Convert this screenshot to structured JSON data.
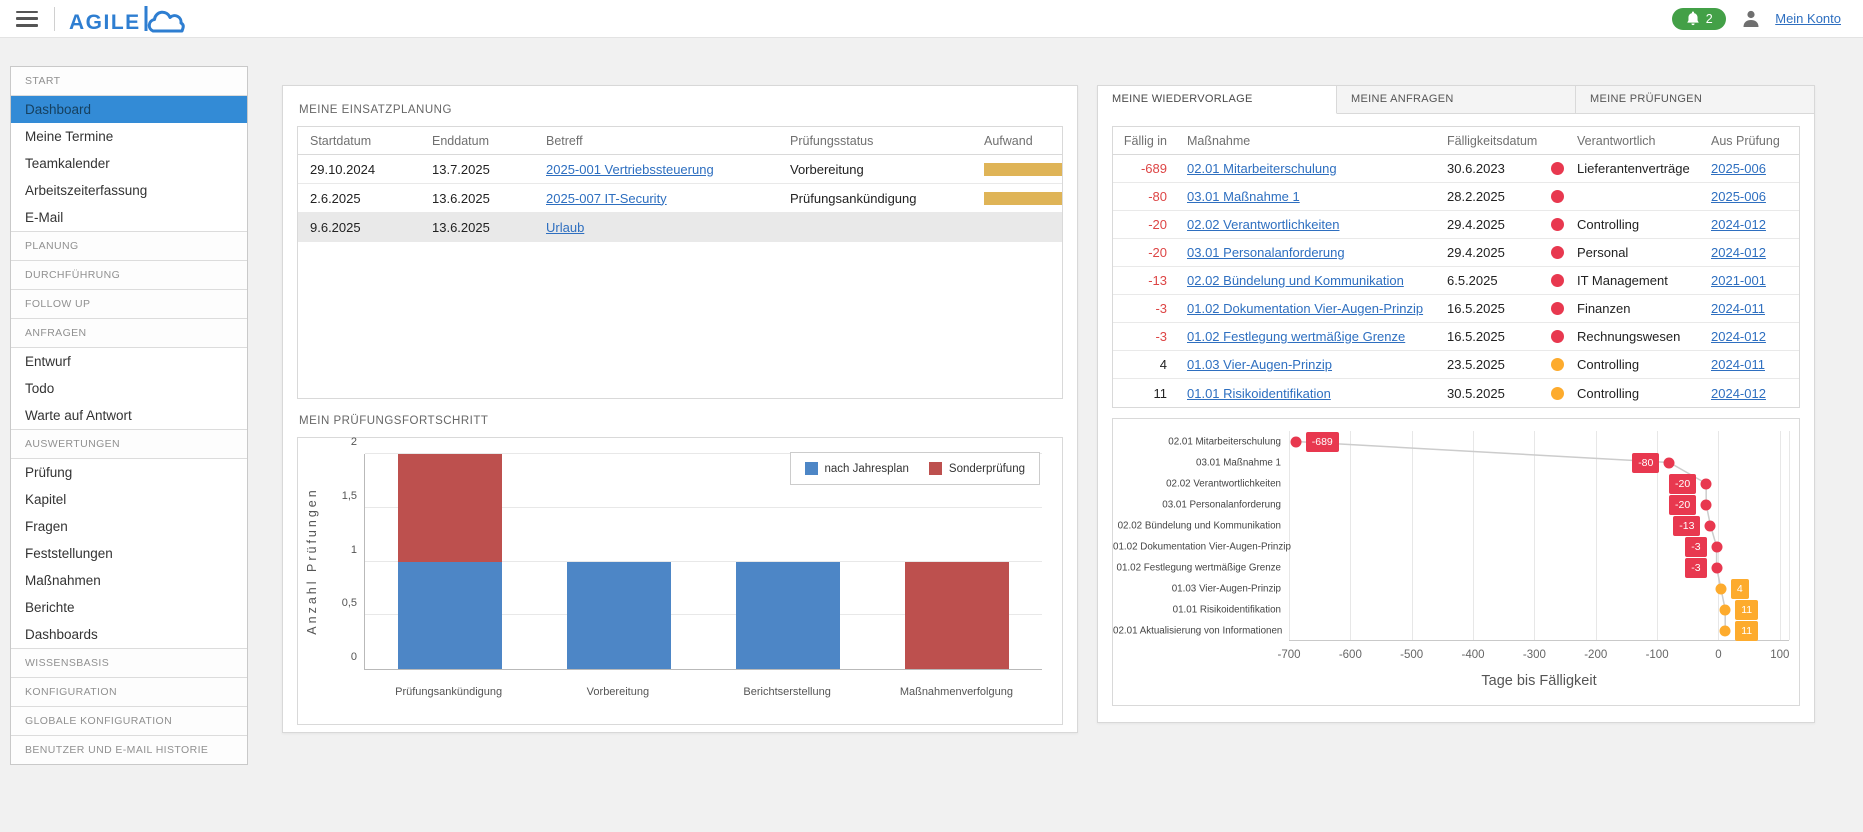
{
  "header": {
    "brand": "AGILE",
    "notification_count": "2",
    "account_link": "Mein Konto"
  },
  "sidebar": {
    "items": [
      {
        "type": "header",
        "label": "START"
      },
      {
        "type": "item",
        "label": "Dashboard",
        "active": true
      },
      {
        "type": "item",
        "label": "Meine Termine"
      },
      {
        "type": "item",
        "label": "Teamkalender"
      },
      {
        "type": "item",
        "label": "Arbeitszeiterfassung"
      },
      {
        "type": "item",
        "label": "E-Mail"
      },
      {
        "type": "header",
        "label": "PLANUNG"
      },
      {
        "type": "header",
        "label": "DURCHFÜHRUNG"
      },
      {
        "type": "header",
        "label": "FOLLOW UP"
      },
      {
        "type": "header",
        "label": "ANFRAGEN"
      },
      {
        "type": "item",
        "label": "Entwurf"
      },
      {
        "type": "item",
        "label": "Todo"
      },
      {
        "type": "item",
        "label": "Warte auf Antwort"
      },
      {
        "type": "header",
        "label": "AUSWERTUNGEN"
      },
      {
        "type": "item",
        "label": "Prüfung"
      },
      {
        "type": "item",
        "label": "Kapitel"
      },
      {
        "type": "item",
        "label": "Fragen"
      },
      {
        "type": "item",
        "label": "Feststellungen"
      },
      {
        "type": "item",
        "label": "Maßnahmen"
      },
      {
        "type": "item",
        "label": "Berichte"
      },
      {
        "type": "item",
        "label": "Dashboards"
      },
      {
        "type": "header",
        "label": "WISSENSBASIS"
      },
      {
        "type": "header",
        "label": "KONFIGURATION"
      },
      {
        "type": "header",
        "label": "GLOBALE KONFIGURATION"
      },
      {
        "type": "header",
        "label": "BENUTZER UND E-MAIL HISTORIE"
      }
    ]
  },
  "einsatzplanung": {
    "title": "MEINE EINSATZPLANUNG",
    "columns": [
      "Startdatum",
      "Enddatum",
      "Betreff",
      "Prüfungsstatus",
      "Aufwand"
    ],
    "rows": [
      {
        "start": "29.10.2024",
        "end": "13.7.2025",
        "betreff": "2025-001 Vertriebssteuerung",
        "status": "Vorbereitung",
        "aufwand": true,
        "selected": false
      },
      {
        "start": "2.6.2025",
        "end": "13.6.2025",
        "betreff": "2025-007 IT-Security",
        "status": "Prüfungsankündigung",
        "aufwand": true,
        "selected": false
      },
      {
        "start": "9.6.2025",
        "end": "13.6.2025",
        "betreff": "Urlaub",
        "status": "",
        "aufwand": false,
        "selected": true
      }
    ]
  },
  "fortschritt": {
    "title": "MEIN PRÜFUNGSFORTSCHRITT"
  },
  "right_panel": {
    "tabs": [
      "MEINE WIEDERVORLAGE",
      "MEINE ANFRAGEN",
      "MEINE PRÜFUNGEN"
    ],
    "active_tab": 0,
    "columns": [
      "Fällig in",
      "Maßnahme",
      "Fälligkeitsdatum",
      "",
      "Verantwortlich",
      "Aus Prüfung"
    ],
    "rows": [
      {
        "faellig": "-689",
        "massnahme": "02.01 Mitarbeiterschulung",
        "datum": "30.6.2023",
        "dot": "red",
        "verantwortlich": "Lieferantenverträge",
        "pruefung": "2025-006"
      },
      {
        "faellig": "-80",
        "massnahme": "03.01 Maßnahme 1",
        "datum": "28.2.2025",
        "dot": "red",
        "verantwortlich": "",
        "pruefung": "2025-006"
      },
      {
        "faellig": "-20",
        "massnahme": "02.02 Verantwortlichkeiten",
        "datum": "29.4.2025",
        "dot": "red",
        "verantwortlich": "Controlling",
        "pruefung": "2024-012"
      },
      {
        "faellig": "-20",
        "massnahme": "03.01 Personalanforderung",
        "datum": "29.4.2025",
        "dot": "red",
        "verantwortlich": "Personal",
        "pruefung": "2024-012"
      },
      {
        "faellig": "-13",
        "massnahme": "02.02 Bündelung und Kommunikation",
        "datum": "6.5.2025",
        "dot": "red",
        "verantwortlich": "IT Management",
        "pruefung": "2021-001"
      },
      {
        "faellig": "-3",
        "massnahme": "01.02 Dokumentation Vier-Augen-Prinzip",
        "datum": "16.5.2025",
        "dot": "red",
        "verantwortlich": "Finanzen",
        "pruefung": "2024-011"
      },
      {
        "faellig": "-3",
        "massnahme": "01.02 Festlegung wertmäßige Grenze",
        "datum": "16.5.2025",
        "dot": "red",
        "verantwortlich": "Rechnungswesen",
        "pruefung": "2024-012"
      },
      {
        "faellig": "4",
        "massnahme": "01.03 Vier-Augen-Prinzip",
        "datum": "23.5.2025",
        "dot": "yellow",
        "verantwortlich": "Controlling",
        "pruefung": "2024-011"
      },
      {
        "faellig": "11",
        "massnahme": "01.01 Risikoidentifikation",
        "datum": "30.5.2025",
        "dot": "yellow",
        "verantwortlich": "Controlling",
        "pruefung": "2024-012"
      }
    ]
  },
  "chart_data": [
    {
      "type": "bar",
      "title": "MEIN PRÜFUNGSFORTSCHRITT",
      "stacked": true,
      "categories": [
        "Prüfungsankündigung",
        "Vorbereitung",
        "Berichtserstellung",
        "Maßnahmenverfolgung"
      ],
      "series": [
        {
          "name": "nach Jahresplan",
          "color": "#4d86c6",
          "values": [
            1,
            1,
            1,
            0
          ]
        },
        {
          "name": "Sonderprüfung",
          "color": "#bd504e",
          "values": [
            1,
            0,
            0,
            1
          ]
        }
      ],
      "ylabel": "Anzahl Prüfungen",
      "ylim": [
        0,
        2
      ],
      "yticks": [
        [
          0,
          "0"
        ],
        [
          0.5,
          "0,5"
        ],
        [
          1,
          "1"
        ],
        [
          1.5,
          "1,5"
        ],
        [
          2,
          "2"
        ]
      ],
      "grid": true,
      "legend_position": "top-right"
    },
    {
      "type": "scatter",
      "xlabel": "Tage bis Fälligkeit",
      "xlim": [
        -700,
        115
      ],
      "xticks": [
        -700,
        -600,
        -500,
        -400,
        -300,
        -200,
        -100,
        0,
        100
      ],
      "grid": true,
      "points": [
        {
          "label": "02.01 Mitarbeiterschulung",
          "value": -689,
          "color": "red"
        },
        {
          "label": "03.01 Maßnahme 1",
          "value": -80,
          "color": "red"
        },
        {
          "label": "02.02 Verantwortlichkeiten",
          "value": -20,
          "color": "red"
        },
        {
          "label": "03.01 Personalanforderung",
          "value": -20,
          "color": "red"
        },
        {
          "label": "02.02 Bündelung und Kommunikation",
          "value": -13,
          "color": "red"
        },
        {
          "label": "01.02 Dokumentation Vier-Augen-Prinzip",
          "value": -3,
          "color": "red"
        },
        {
          "label": "01.02 Festlegung wertmäßige Grenze",
          "value": -3,
          "color": "red"
        },
        {
          "label": "01.03 Vier-Augen-Prinzip",
          "value": 4,
          "color": "orange"
        },
        {
          "label": "01.01 Risikoidentifikation",
          "value": 11,
          "color": "orange"
        },
        {
          "label": "02.01 Aktualisierung von Informationen",
          "value": 11,
          "color": "orange"
        }
      ]
    }
  ],
  "colors": {
    "red": "#e8384f",
    "orange": "#fdab2d",
    "bar_blue": "#4d86c6",
    "bar_red": "#bd504e",
    "aufwand_gold": "#dfb457",
    "accent_blue": "#2e7ed1",
    "green": "#43a047"
  }
}
